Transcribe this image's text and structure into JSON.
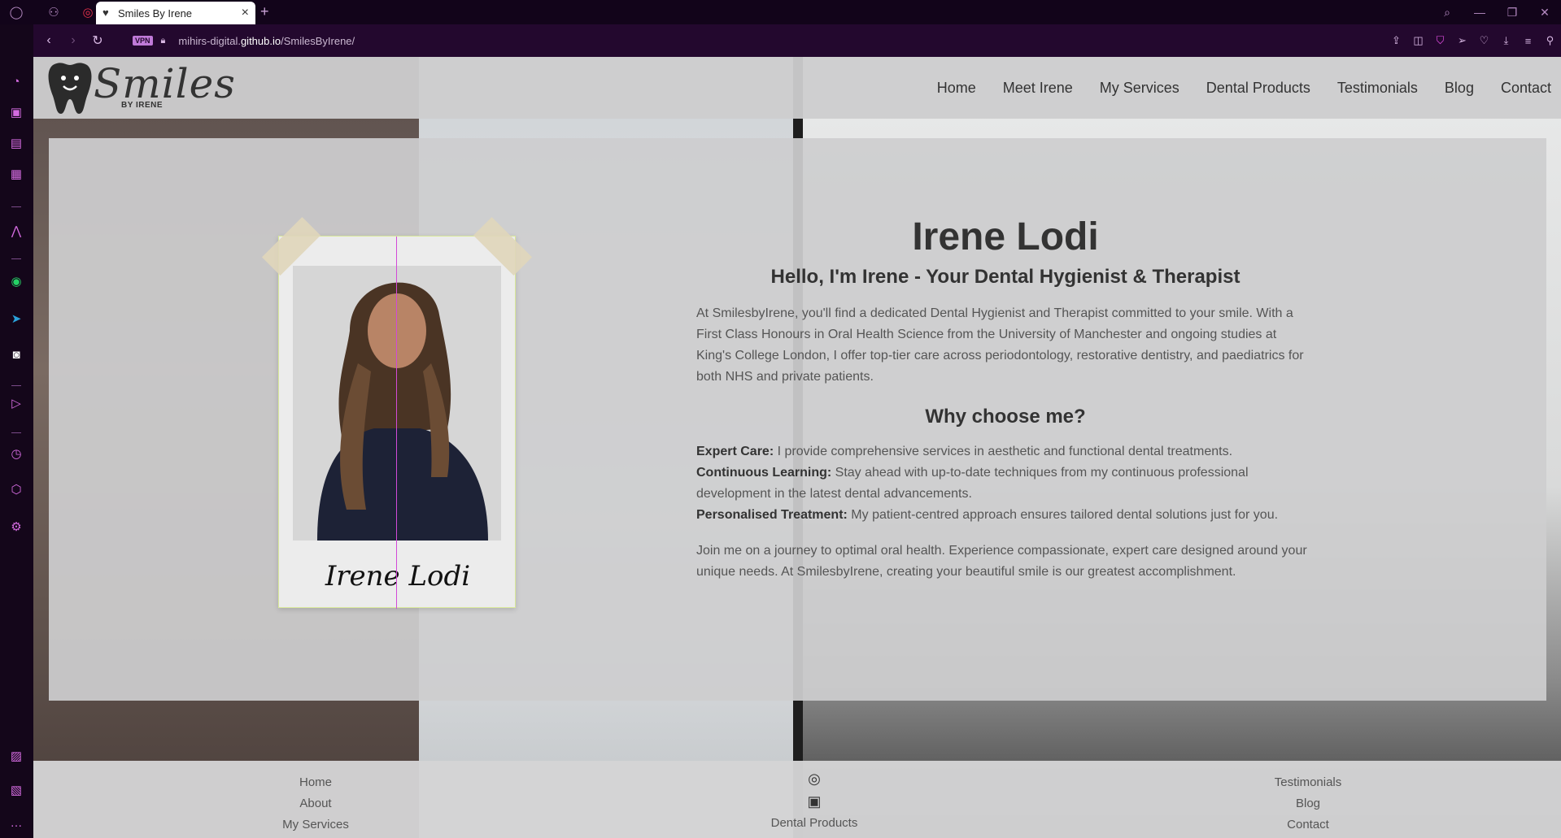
{
  "browser": {
    "tab_title": "Smiles By Irene",
    "vpn_label": "VPN",
    "url_prefix": "mihirs-digital.",
    "url_domain": "github.io",
    "url_path": "/SmilesByIrene/"
  },
  "site": {
    "logo_text": "Smiles",
    "logo_sub": "BY IRENE",
    "nav": [
      "Home",
      "Meet Irene",
      "My Services",
      "Dental Products",
      "Testimonials",
      "Blog",
      "Contact"
    ]
  },
  "profile": {
    "signature": "Irene Lodi",
    "name": "Irene Lodi",
    "subtitle": "Hello, I'm Irene - Your Dental Hygienist & Therapist",
    "intro": "At SmilesbyIrene, you'll find a dedicated Dental Hygienist and Therapist committed to your smile. With a First Class Honours in Oral Health Science from the University of Manchester and ongoing studies at King's College London, I offer top-tier care across periodontology, restorative dentistry, and paediatrics for both NHS and private patients.",
    "why_heading": "Why choose me?",
    "reasons": [
      {
        "title": "Expert Care:",
        "text": " I provide comprehensive services in aesthetic and functional dental treatments."
      },
      {
        "title": "Continuous Learning:",
        "text": " Stay ahead with up-to-date techniques from my continuous professional development in the latest dental advancements."
      },
      {
        "title": "Personalised Treatment:",
        "text": " My patient-centred approach ensures tailored dental solutions just for you."
      }
    ],
    "closing": "Join me on a journey to optimal oral health. Experience compassionate, expert care designed around your unique needs. At SmilesbyIrene, creating your beautiful smile is our greatest accomplishment."
  },
  "footer": {
    "left_links": [
      "Home",
      "About",
      "My Services"
    ],
    "center_link": "Dental Products",
    "right_links": [
      "Testimonials",
      "Blog",
      "Contact"
    ],
    "social_icons": [
      "instagram-icon",
      "linkedin-icon"
    ]
  }
}
